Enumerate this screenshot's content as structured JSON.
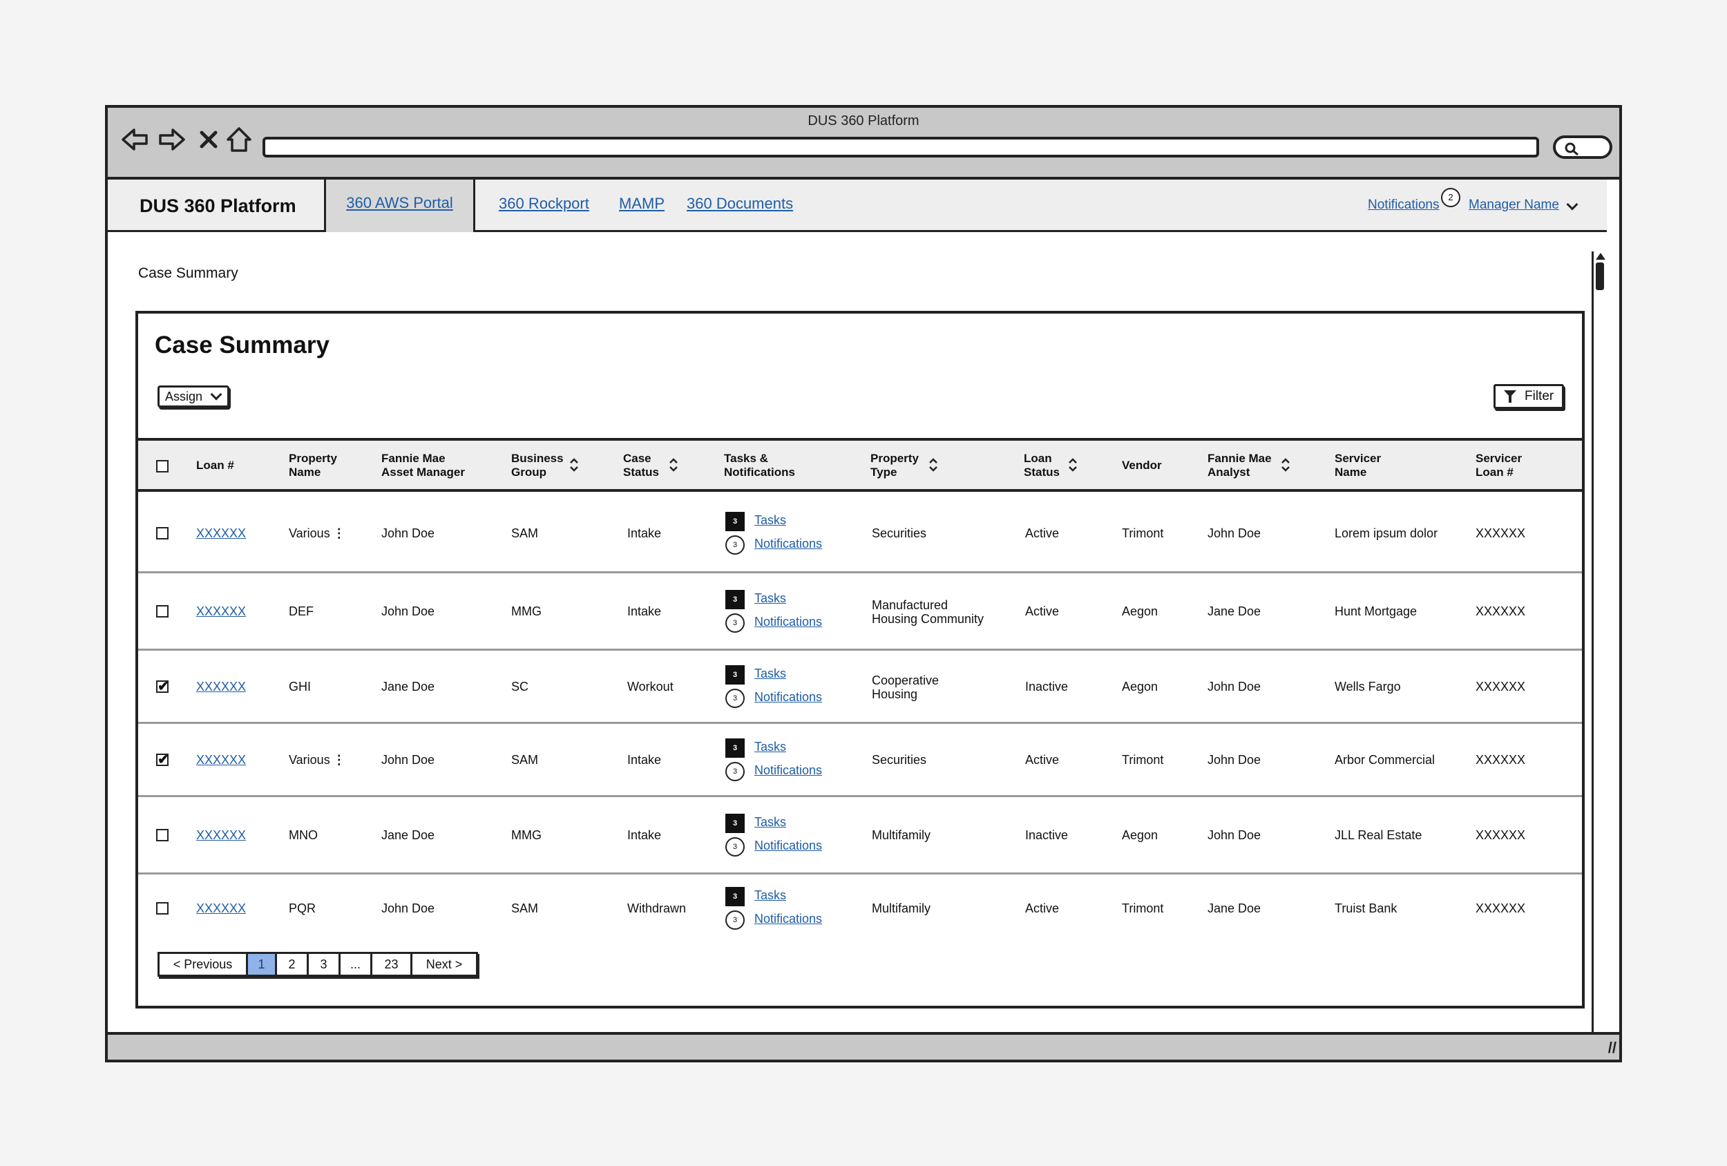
{
  "window": {
    "title": "DUS 360 Platform"
  },
  "app_nav": {
    "brand": "DUS 360 Platform",
    "links": [
      "360 AWS Portal",
      "360 Rockport",
      "MAMP",
      "360 Documents"
    ],
    "notifications_label": "Notifications",
    "notifications_count": "2",
    "user_menu": "Manager Name"
  },
  "breadcrumb": "Case Summary",
  "panel": {
    "title": "Case Summary",
    "assign_label": "Assign",
    "filter_label": "Filter"
  },
  "table": {
    "headers": {
      "loan": "Loan #",
      "property_name": "Property\nName",
      "asset_manager": "Fannie Mae\nAsset Manager",
      "business_group": "Business\nGroup",
      "case_status": "Case\nStatus",
      "tasks_notifications": "Tasks &\nNotifications",
      "property_type": "Property\nType",
      "loan_status": "Loan\nStatus",
      "vendor": "Vendor",
      "analyst": "Fannie Mae\nAnalyst",
      "servicer_name": "Servicer\nName",
      "servicer_loan": "Servicer\nLoan #"
    },
    "rows": [
      {
        "checked": false,
        "loan": "XXXXXX",
        "property_name": "Various",
        "more": "⋮",
        "asset_manager": "John Doe",
        "business_group": "SAM",
        "case_status": "Intake",
        "tasks_count": "3",
        "tasks_label": "Tasks",
        "notif_count": "3",
        "notif_label": "Notifications",
        "property_type": "Securities",
        "loan_status": "Active",
        "vendor": "Trimont",
        "analyst": "John Doe",
        "servicer_name": "Lorem ipsum dolor",
        "servicer_loan": "XXXXXX"
      },
      {
        "checked": false,
        "loan": "XXXXXX",
        "property_name": "DEF",
        "more": "",
        "asset_manager": "John Doe",
        "business_group": "MMG",
        "case_status": "Intake",
        "tasks_count": "3",
        "tasks_label": "Tasks",
        "notif_count": "3",
        "notif_label": "Notifications",
        "property_type": "Manufactured\nHousing Community",
        "loan_status": "Active",
        "vendor": "Aegon",
        "analyst": "Jane Doe",
        "servicer_name": "Hunt Mortgage",
        "servicer_loan": "XXXXXX"
      },
      {
        "checked": true,
        "loan": "XXXXXX",
        "property_name": "GHI",
        "more": "",
        "asset_manager": "Jane Doe",
        "business_group": "SC",
        "case_status": "Workout",
        "tasks_count": "3",
        "tasks_label": "Tasks",
        "notif_count": "3",
        "notif_label": "Notifications",
        "property_type": "Cooperative\nHousing",
        "loan_status": "Inactive",
        "vendor": "Aegon",
        "analyst": "John Doe",
        "servicer_name": "Wells Fargo",
        "servicer_loan": "XXXXXX"
      },
      {
        "checked": true,
        "loan": "XXXXXX",
        "property_name": "Various",
        "more": "⋮",
        "asset_manager": "John Doe",
        "business_group": "SAM",
        "case_status": "Intake",
        "tasks_count": "3",
        "tasks_label": "Tasks",
        "notif_count": "3",
        "notif_label": "Notifications",
        "property_type": "Securities",
        "loan_status": "Active",
        "vendor": "Trimont",
        "analyst": "John Doe",
        "servicer_name": "Arbor Commercial",
        "servicer_loan": "XXXXXX"
      },
      {
        "checked": false,
        "loan": "XXXXXX",
        "property_name": "MNO",
        "more": "",
        "asset_manager": "Jane Doe",
        "business_group": "MMG",
        "case_status": "Intake",
        "tasks_count": "3",
        "tasks_label": "Tasks",
        "notif_count": "3",
        "notif_label": "Notifications",
        "property_type": "Multifamily",
        "loan_status": "Inactive",
        "vendor": "Aegon",
        "analyst": "John Doe",
        "servicer_name": "JLL Real Estate",
        "servicer_loan": "XXXXXX"
      },
      {
        "checked": false,
        "loan": "XXXXXX",
        "property_name": "PQR",
        "more": "",
        "asset_manager": "John Doe",
        "business_group": "SAM",
        "case_status": "Withdrawn",
        "tasks_count": "3",
        "tasks_label": "Tasks",
        "notif_count": "3",
        "notif_label": "Notifications",
        "property_type": "Multifamily",
        "loan_status": "Active",
        "vendor": "Trimont",
        "analyst": "Jane Doe",
        "servicer_name": "Truist Bank",
        "servicer_loan": "XXXXXX"
      }
    ]
  },
  "pagination": {
    "previous": "< Previous",
    "pages": [
      "1",
      "2",
      "3",
      "...",
      "23"
    ],
    "active_page": "1",
    "next": "Next >"
  },
  "colors": {
    "link": "#1f5da6",
    "active_page": "#8fb3e8",
    "chrome": "#c8c8c8"
  }
}
